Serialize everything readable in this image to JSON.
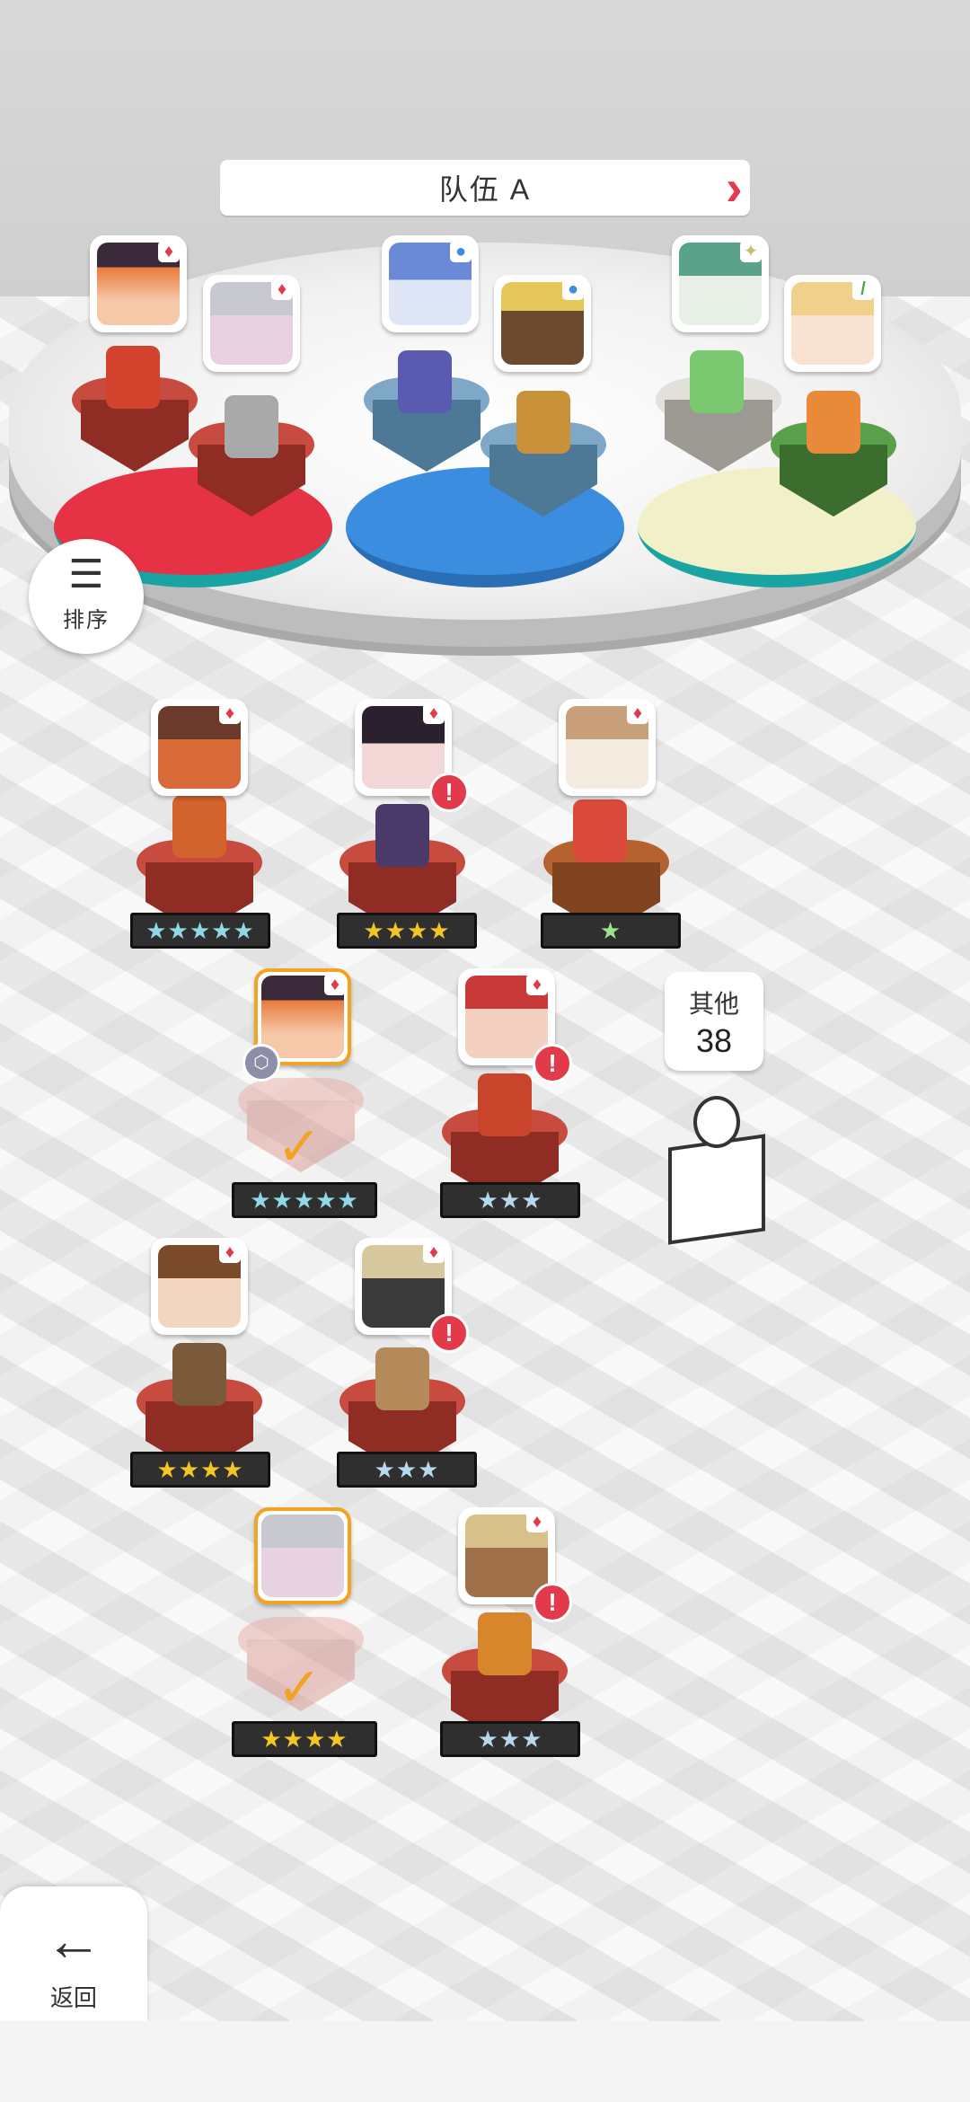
{
  "team": {
    "title": "队伍 A",
    "prev_icon": "chevron-left-icon",
    "next_icon": "chevron-right-icon"
  },
  "sort": {
    "label": "排序",
    "icon": "sort-icon"
  },
  "back": {
    "label": "返回",
    "icon": "arrow-left-icon"
  },
  "others": {
    "label": "其他",
    "count": "38"
  },
  "colors": {
    "red": "#e2394b",
    "blue": "#3b8de0",
    "cream": "#f2f0c8",
    "orange": "#f3a223",
    "teal": "#1aa3a3"
  },
  "team_slots": [
    {
      "color": "red",
      "badge": "♦"
    },
    {
      "color": "red",
      "badge": "♦"
    },
    {
      "color": "blue",
      "badge": "●"
    },
    {
      "color": "blue",
      "badge": "●"
    },
    {
      "color": "white",
      "badge": "✦"
    },
    {
      "color": "green",
      "badge": "/"
    }
  ],
  "roster": [
    {
      "stars": "★★★★★",
      "alert": false,
      "selected": false
    },
    {
      "stars": "★★★★",
      "alert": true,
      "selected": false
    },
    {
      "stars": "★",
      "alert": false,
      "selected": false
    },
    {
      "stars": "★★★★★",
      "alert": false,
      "selected": true
    },
    {
      "stars": "★★★",
      "alert": true,
      "selected": false
    },
    {
      "stars": "★★★★",
      "alert": false,
      "selected": false
    },
    {
      "stars": "★★★",
      "alert": true,
      "selected": false
    },
    {
      "stars": "★★★★",
      "alert": false,
      "selected": true
    },
    {
      "stars": "★★★",
      "alert": true,
      "selected": false
    }
  ]
}
